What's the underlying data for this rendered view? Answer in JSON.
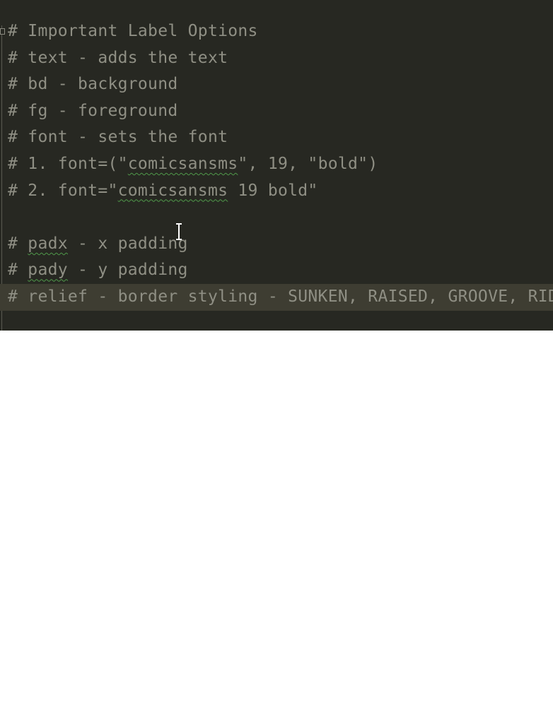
{
  "editor": {
    "lines": [
      {
        "parts": [
          {
            "text": "# Important Label Options"
          }
        ]
      },
      {
        "parts": [
          {
            "text": "# text - adds the text"
          }
        ]
      },
      {
        "parts": [
          {
            "text": "# bd - background"
          }
        ]
      },
      {
        "parts": [
          {
            "text": "# fg - foreground"
          }
        ]
      },
      {
        "parts": [
          {
            "text": "# font - sets the font"
          }
        ]
      },
      {
        "parts": [
          {
            "text": "# 1. font=(\""
          },
          {
            "text": "comicsansms"
          },
          {
            "text": "\", 19, \"bold\")"
          }
        ]
      },
      {
        "parts": [
          {
            "text": "# 2. font=\""
          },
          {
            "text": "comicsansms"
          },
          {
            "text": " 19 bold\""
          }
        ]
      },
      {
        "parts": [
          {
            "text": ""
          }
        ]
      },
      {
        "parts": [
          {
            "text": "# "
          },
          {
            "text": "padx"
          },
          {
            "text": " - x padding"
          }
        ]
      },
      {
        "parts": [
          {
            "text": "# "
          },
          {
            "text": "pady"
          },
          {
            "text": " - y padding"
          }
        ]
      },
      {
        "parts": [
          {
            "text": "# relief - border styling - SUNKEN, RAISED, GROOVE, RIDGE"
          }
        ]
      }
    ],
    "colors": {
      "background": "#272822",
      "comment": "#8f8f84",
      "current_line": "#3e3d32",
      "spell_squiggle": "#4f9a4a"
    },
    "icons": {
      "fold": "fold-marker-icon",
      "cursor": "text-cursor-icon"
    }
  }
}
